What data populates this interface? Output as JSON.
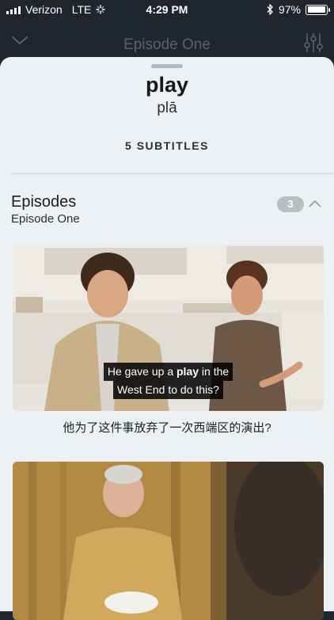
{
  "status_bar": {
    "carrier": "Verizon",
    "network": "LTE",
    "time": "4:29 PM",
    "battery": "97%",
    "battery_level": 0.97
  },
  "nav": {
    "title": "Episode One"
  },
  "word_card": {
    "word": "play",
    "pinyin": "plā",
    "subtitle_count": "5 SUBTITLES"
  },
  "episodes": {
    "title": "Episodes",
    "subtitle": "Episode One",
    "count": "3"
  },
  "clips": [
    {
      "caption_before": "He gave up a ",
      "caption_highlight": "play",
      "caption_after": " in the",
      "caption_line2": "West End to do this?",
      "translation": "他为了这件事放弃了一次西端区的演出?"
    },
    {}
  ],
  "colors": {
    "background": "#1f262d",
    "sheet": "#eef1f4",
    "badge": "#b9bec4"
  }
}
